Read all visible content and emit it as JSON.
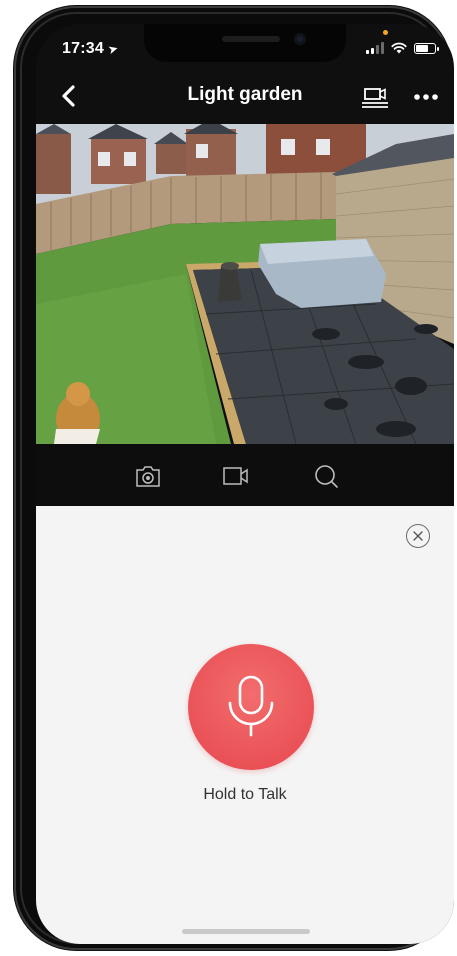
{
  "status_bar": {
    "time": "17:34",
    "location_arrow": "location-arrow-icon",
    "icons": [
      "cellular-signal-icon",
      "wifi-icon",
      "battery-icon"
    ]
  },
  "nav": {
    "title": "Light garden",
    "back_icon": "chevron-left-icon",
    "device_icon": "camera-device-list-icon",
    "more_icon": "more-dots-icon"
  },
  "controls": {
    "items": [
      {
        "icon": "snapshot-camera-icon"
      },
      {
        "icon": "video-record-icon"
      },
      {
        "icon": "search-icon"
      }
    ]
  },
  "talk": {
    "label": "Hold to Talk",
    "mic_icon": "microphone-icon",
    "close_icon": "close-icon"
  },
  "colors": {
    "talk_button": "#ea5257",
    "nav_background": "#0f0f10",
    "panel_background": "#f4f4f4"
  }
}
